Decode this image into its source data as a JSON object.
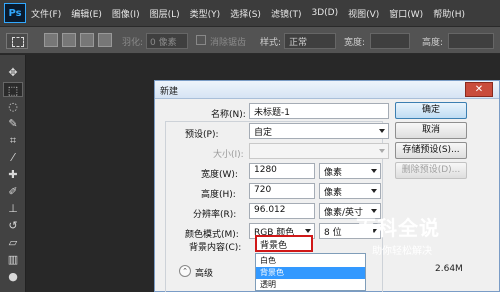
{
  "menubar": {
    "logo": "Ps",
    "items": [
      "文件(F)",
      "编辑(E)",
      "图像(I)",
      "图层(L)",
      "类型(Y)",
      "选择(S)",
      "滤镜(T)",
      "3D(D)",
      "视图(V)",
      "窗口(W)",
      "帮助(H)"
    ]
  },
  "options": {
    "feather_label": "羽化:",
    "feather_value": "0 像素",
    "antialias_label": "消除锯齿",
    "style_label": "样式:",
    "style_value": "正常",
    "width_label": "宽度:",
    "height_label": "高度:"
  },
  "toolbox": {
    "tools": [
      "move",
      "marquee",
      "lasso",
      "quick-select",
      "crop",
      "eyedropper",
      "healing",
      "brush",
      "clone-stamp",
      "history-brush",
      "eraser",
      "gradient",
      "blur",
      "dodge"
    ]
  },
  "dialog": {
    "title": "新建",
    "close": "✕",
    "name_label": "名称(N):",
    "name_value": "未标题-1",
    "preset_label": "预设(P):",
    "preset_value": "自定",
    "size_label": "大小(I):",
    "width_label": "宽度(W):",
    "width_value": "1280",
    "width_unit": "像素",
    "height_label": "高度(H):",
    "height_value": "720",
    "height_unit": "像素",
    "resolution_label": "分辨率(R):",
    "resolution_value": "96.012",
    "resolution_unit": "像素/英寸",
    "color_mode_label": "颜色模式(M):",
    "color_mode_value": "RGB 颜色",
    "bit_depth_value": "8 位",
    "bg_label": "背景内容(C):",
    "bg_value": "背景色",
    "bg_options": [
      "白色",
      "背景色",
      "透明"
    ],
    "bg_selected_index": 1,
    "advanced_label": "高级",
    "file_size": "2.64M",
    "buttons": {
      "ok": "确定",
      "cancel": "取消",
      "save_preset": "存储预设(S)...",
      "delete_preset": "删除预设(D)..."
    }
  },
  "watermark": {
    "main": "百科全说",
    "sub": "助你轻松解决"
  }
}
